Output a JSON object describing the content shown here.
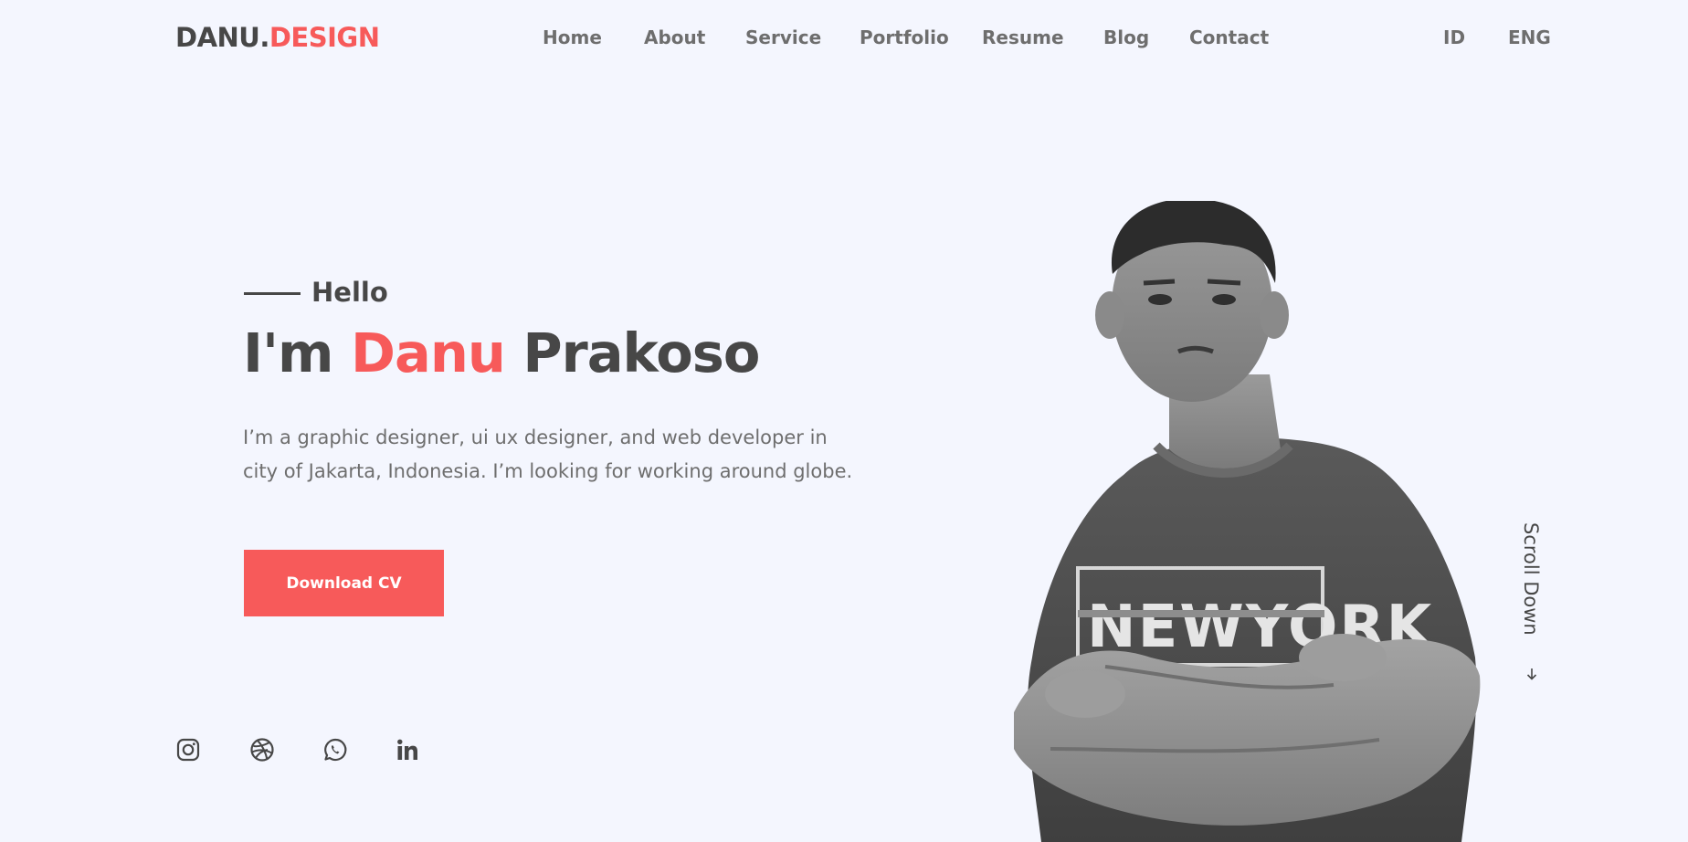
{
  "header": {
    "logo_main": "DANU.",
    "logo_accent": "DESIGN",
    "nav": [
      "Home",
      "About",
      "Service",
      "Portfolio",
      "Resume",
      "Blog",
      "Contact"
    ],
    "languages": [
      "ID",
      "ENG"
    ]
  },
  "hero": {
    "greeting": "Hello",
    "title_prefix": "I'm ",
    "title_accent": "Danu",
    "title_suffix": " Prakoso",
    "description": "I’m a graphic designer, ui ux designer, and web developer in city of Jakarta, Indonesia. I’m looking for working around globe.",
    "cta_label": "Download CV"
  },
  "social": [
    {
      "icon": "instagram-icon"
    },
    {
      "icon": "dribbble-icon"
    },
    {
      "icon": "whatsapp-icon"
    },
    {
      "icon": "linkedin-icon"
    }
  ],
  "scroll": {
    "label": "Scroll Down",
    "icon": "arrow-down-icon"
  },
  "colors": {
    "background": "#f4f6fe",
    "accent": "#f75a5a",
    "text_dark": "#474747",
    "text_muted": "#6e6e6e"
  }
}
